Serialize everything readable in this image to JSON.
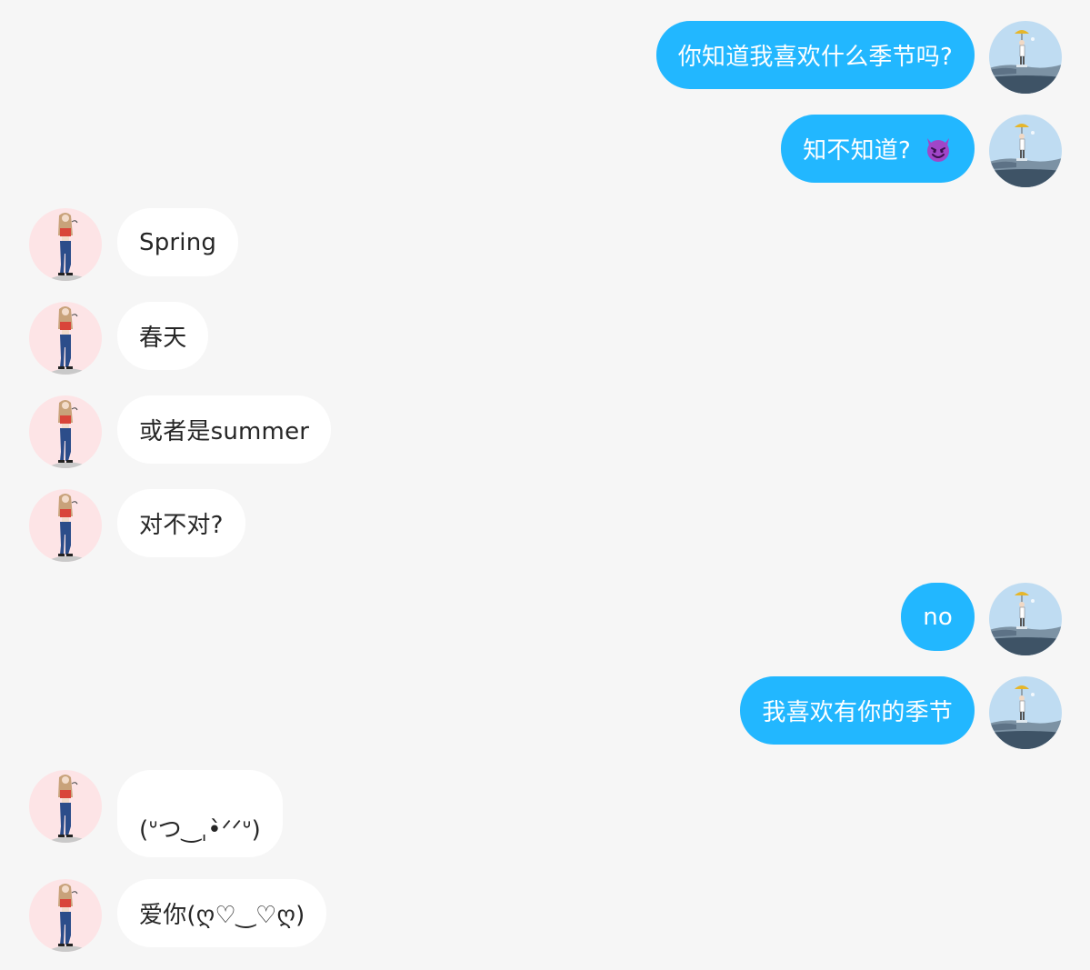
{
  "conversation": {
    "messages": [
      {
        "side": "right",
        "text": "你知道我喜欢什么季节吗?"
      },
      {
        "side": "right",
        "text": "知不知道?",
        "emoji": "smiling-devil-emoji"
      },
      {
        "side": "left",
        "text": "Spring"
      },
      {
        "side": "left",
        "text": "春天"
      },
      {
        "side": "left",
        "text": "或者是summer"
      },
      {
        "side": "left",
        "text": "对不对?"
      },
      {
        "side": "right",
        "text": "no"
      },
      {
        "side": "right",
        "text": "我喜欢有你的季节"
      },
      {
        "side": "left",
        "text": "(ᐡつ‿ˌ•̀ᐟᐟᐡ)"
      },
      {
        "side": "left",
        "text": "爱你(ღ♡‿♡ღ)"
      }
    ]
  },
  "colors": {
    "background": "#f6f6f6",
    "my_bubble": "#22b7ff",
    "their_bubble": "#ffffff",
    "their_avatar_bg": "#fde4e6",
    "my_avatar_sky": "#bfdcf2",
    "emoji_purple": "#a046c8"
  },
  "icons": {
    "my_avatar": "person-with-umbrella-by-sea-avatar",
    "their_avatar": "standing-girl-avatar"
  }
}
